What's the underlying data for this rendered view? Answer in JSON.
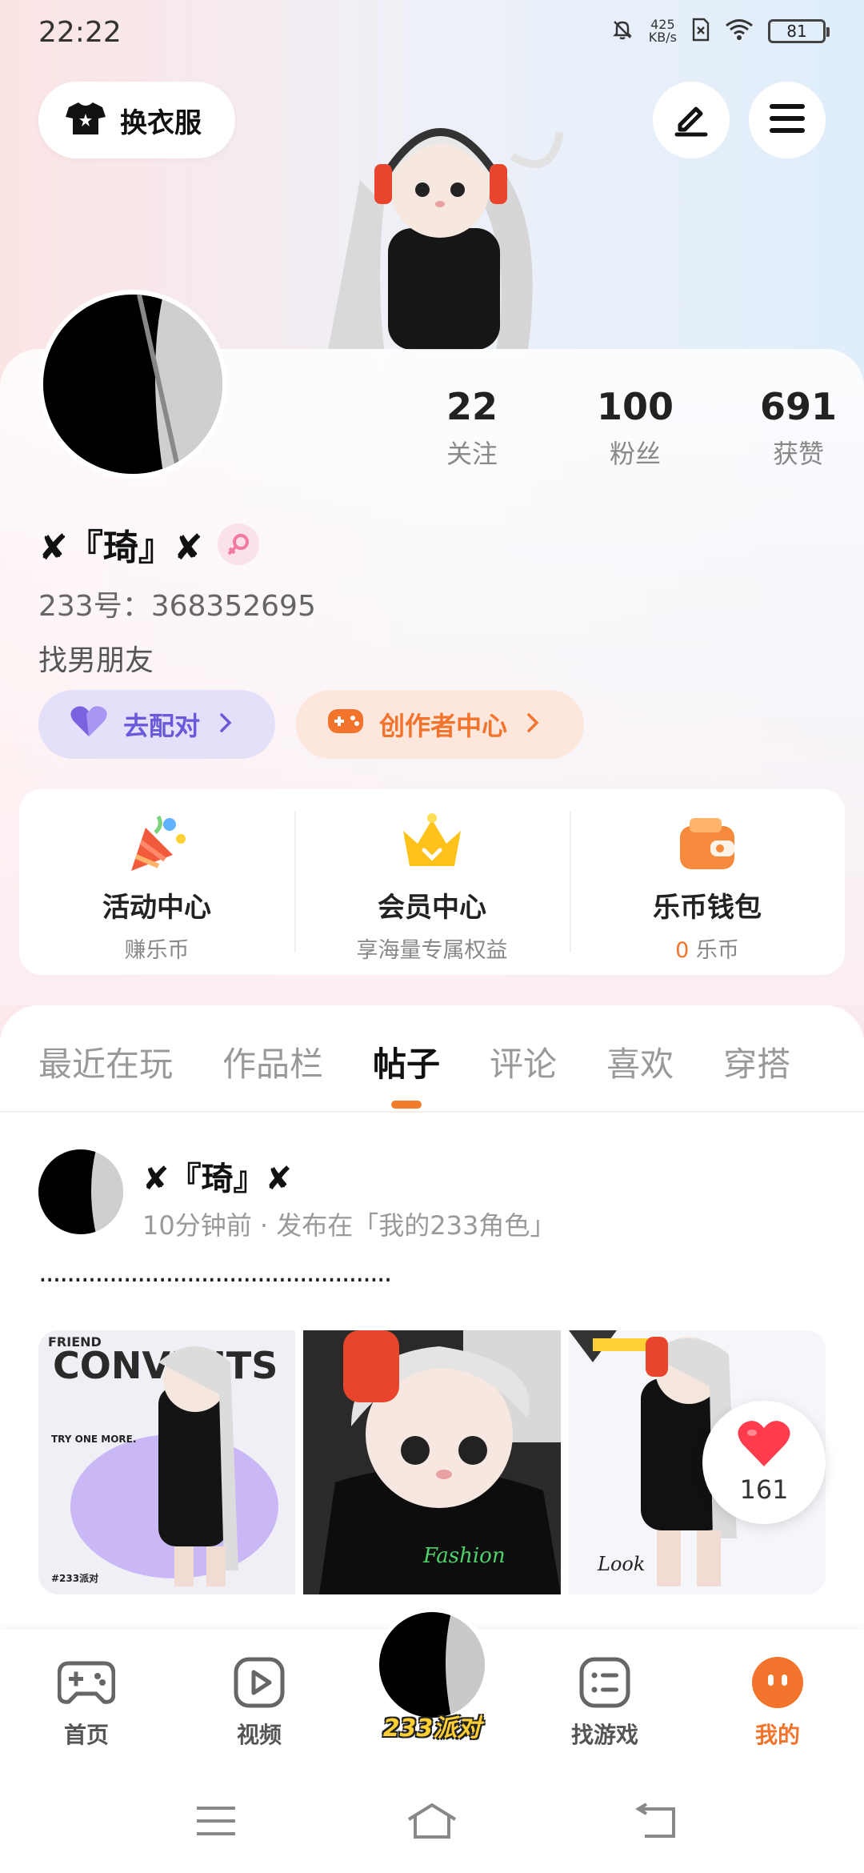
{
  "status_bar": {
    "time": "22:22",
    "net_speed_value": "425",
    "net_speed_unit": "KB/s",
    "battery": "81"
  },
  "header": {
    "outfit_button": "换衣服"
  },
  "profile": {
    "stats": [
      {
        "value": "22",
        "label": "关注"
      },
      {
        "value": "100",
        "label": "粉丝"
      },
      {
        "value": "691",
        "label": "获赞"
      }
    ],
    "username": "✘『琦』✘",
    "user_id": "233号：368352695",
    "bio": "找男朋友",
    "match_button": "去配对",
    "creator_button": "创作者中心"
  },
  "quick_actions": [
    {
      "title": "活动中心",
      "subtitle": "赚乐币",
      "icon": "party-popper-icon"
    },
    {
      "title": "会员中心",
      "subtitle": "享海量专属权益",
      "icon": "crown-icon"
    },
    {
      "title": "乐币钱包",
      "subtitle_highlight": "0",
      "subtitle": "乐币",
      "icon": "wallet-icon"
    }
  ],
  "tabs": [
    {
      "label": "最近在玩"
    },
    {
      "label": "作品栏"
    },
    {
      "label": "帖子",
      "active": true
    },
    {
      "label": "评论"
    },
    {
      "label": "喜欢"
    },
    {
      "label": "穿搭"
    }
  ],
  "post": {
    "author": "✘『琦』✘",
    "meta": "10分钟前 · 发布在「我的233角色」",
    "text": "..................................................",
    "image1_text_top": "FRIEND",
    "image1_text_big": "CONVENTS",
    "image1_text_mid": "TRY ONE MORE.",
    "image1_text_bottom": "#233派对",
    "image2_text": "Fashion",
    "image3_text": "Look",
    "likes": "161"
  },
  "bottom_nav": {
    "items": [
      {
        "label": "首页",
        "icon": "gamepad-icon"
      },
      {
        "label": "视频",
        "icon": "video-play-icon"
      },
      {
        "label": "233派对",
        "icon": "party-avatar"
      },
      {
        "label": "找游戏",
        "icon": "list-icon"
      },
      {
        "label": "我的",
        "icon": "profile-face-icon",
        "active": true
      }
    ]
  },
  "colors": {
    "accent_orange": "#f2732c",
    "match_purple": "#6a5ad9",
    "like_red": "#ff3b4e"
  }
}
